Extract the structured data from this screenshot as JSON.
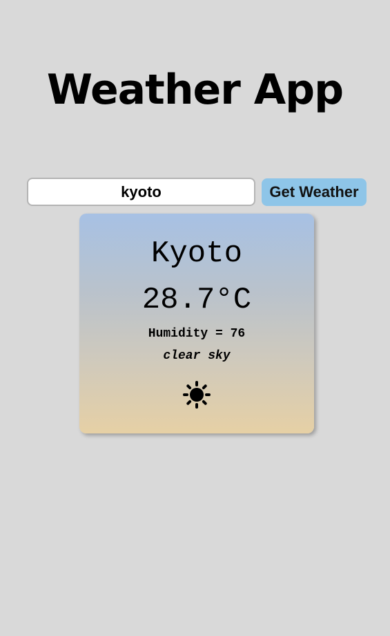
{
  "app": {
    "title": "Weather App"
  },
  "search": {
    "value": "kyoto",
    "button_label": "Get Weather"
  },
  "weather": {
    "city": "Kyoto",
    "temperature": "28.7°C",
    "humidity": "Humidity = 76",
    "description": "clear sky",
    "icon": "sun-icon"
  },
  "colors": {
    "background": "#d9d9d9",
    "button": "#8ec5e8",
    "card_gradient_top": "#a7c1e4",
    "card_gradient_bottom": "#e6d0a5"
  }
}
